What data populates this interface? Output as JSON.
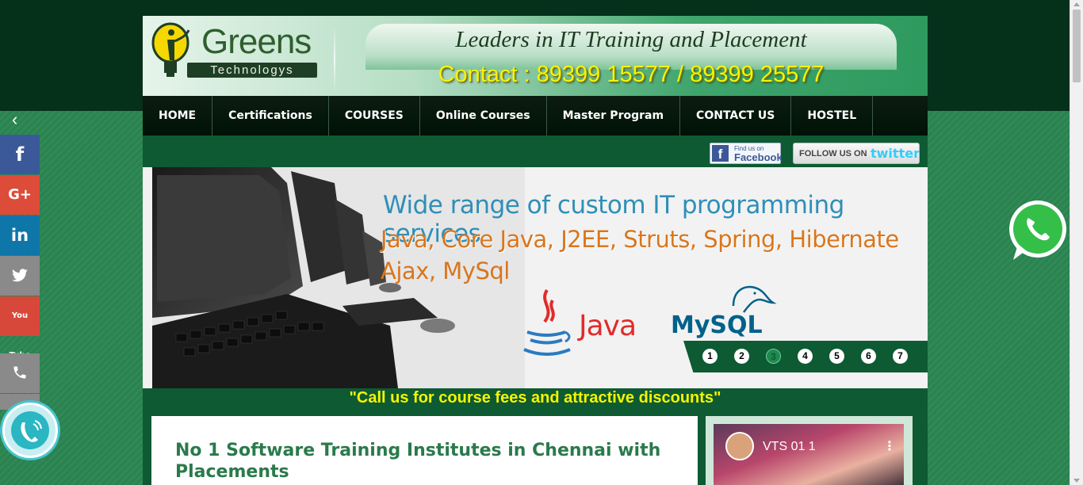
{
  "brand": {
    "name": "Greens",
    "sub": "Technologys",
    "tagline": "Leaders in IT Training and Placement",
    "contact": "Contact : 89399 15577 / 89399 25577"
  },
  "nav": {
    "items": [
      {
        "label": "HOME"
      },
      {
        "label": "Certifications"
      },
      {
        "label": "COURSES"
      },
      {
        "label": "Online Courses"
      },
      {
        "label": "Master Program"
      },
      {
        "label": "CONTACT US"
      },
      {
        "label": "HOSTEL"
      }
    ]
  },
  "follow": {
    "facebook_small": "Find us on",
    "facebook_big": "Facebook",
    "twitter_small": "FOLLOW US ON",
    "twitter_big": "twitter"
  },
  "banner": {
    "line1": "Wide range of custom IT programming services",
    "line2": "Java, Core Java, J2EE, Struts, Spring, Hibernate",
    "line3": "Ajax, MySql",
    "java_label": "Java",
    "mysql_label": "MySQL",
    "slides": [
      "1",
      "2",
      "3",
      "4",
      "5",
      "6",
      "7"
    ],
    "active_slide": "3"
  },
  "callout": "\"Call us for course fees and attractive discounts\"",
  "main": {
    "title": "No 1 Software Training Institutes in Chennai with Placements"
  },
  "video": {
    "title": "VTS 01 1",
    "menu": "⋮"
  },
  "sidebar": {
    "toggle": "‹",
    "facebook": "f",
    "google_plus": "G+",
    "linkedin": "in",
    "youtube": "You Tube"
  },
  "colors": {
    "brand_green": "#0e5a33",
    "nav_bg": "#001207",
    "highlight_yellow": "#f5f500",
    "title_green": "#2a7a4b"
  }
}
